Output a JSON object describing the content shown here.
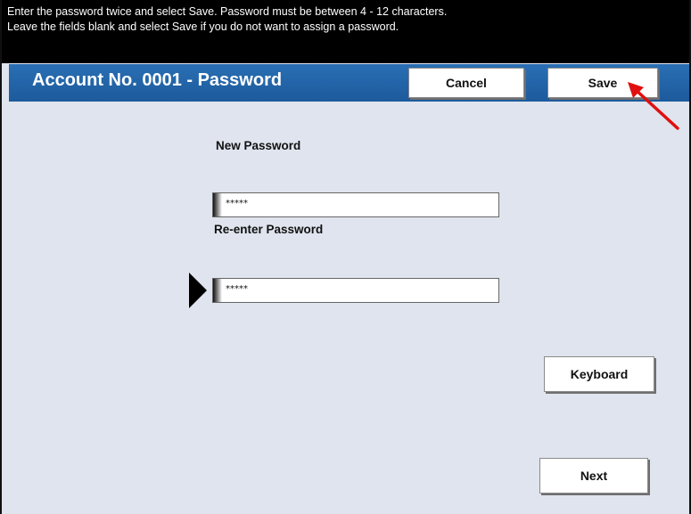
{
  "instructions": {
    "line1": "Enter the password twice and select Save.  Password must be between 4 - 12 characters.",
    "line2": "Leave the fields blank and select Save if you do not want to assign a password."
  },
  "header": {
    "title": "Account No. 0001 - Password",
    "cancel_label": "Cancel",
    "save_label": "Save"
  },
  "form": {
    "new_password_label": "New Password",
    "new_password_value": "*****",
    "reenter_label": "Re-enter Password",
    "reenter_value": "*****"
  },
  "buttons": {
    "keyboard_label": "Keyboard",
    "next_label": "Next"
  },
  "colors": {
    "titlebar": "#1f63a8",
    "panel": "#dfe4ee",
    "annotation_arrow": "#e01010"
  },
  "icons": {
    "focus_pointer": "triangle-right-icon",
    "annotation": "red-arrow-icon"
  }
}
